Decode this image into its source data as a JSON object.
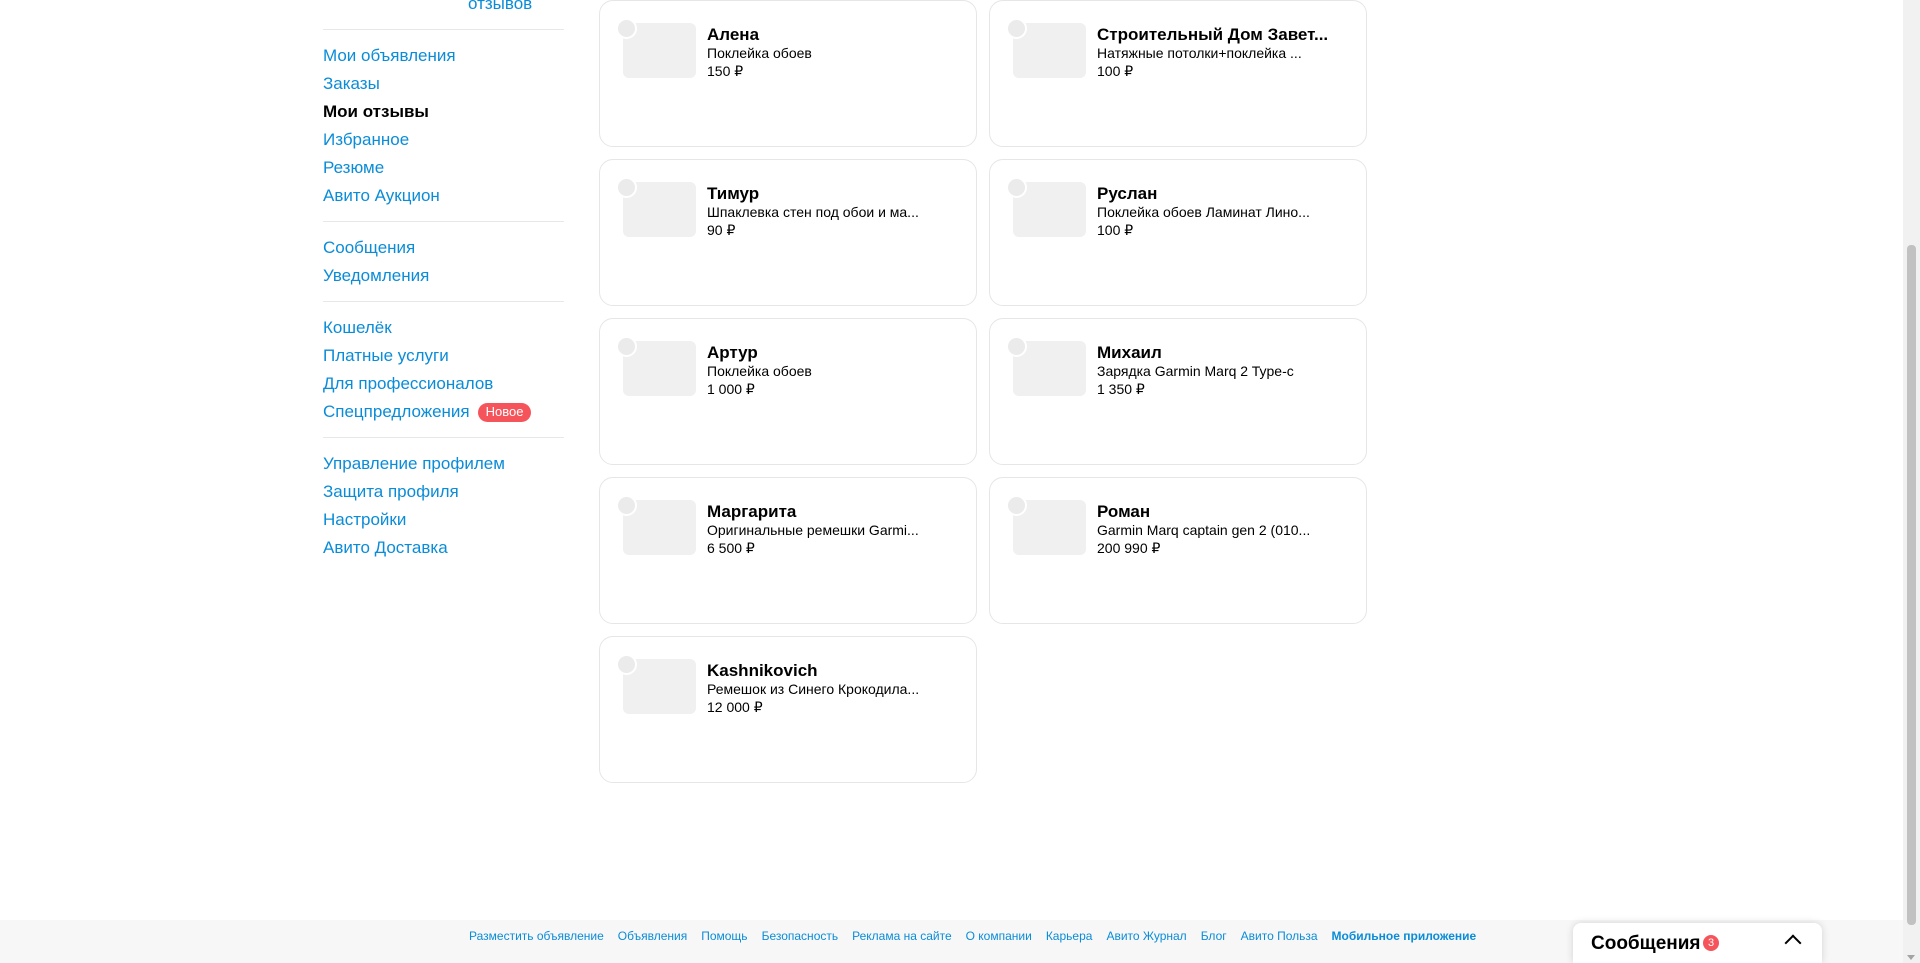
{
  "sidebar": {
    "reviews_fragment": "отзывов",
    "groups": [
      [
        "Мои объявления",
        "Заказы",
        "Мои отзывы",
        "Избранное",
        "Резюме",
        "Авито Аукцион"
      ],
      [
        "Сообщения",
        "Уведомления"
      ],
      [
        "Кошелёк",
        "Платные услуги",
        "Для профессионалов",
        "Спецпредложения"
      ],
      [
        "Управление профилем",
        "Защита профиля",
        "Настройки",
        "Авито Доставка"
      ]
    ],
    "active_item": "Мои отзывы",
    "new_badge": "Новое"
  },
  "cards": [
    {
      "name": "Алена",
      "title": "Поклейка обоев",
      "price": "150 ₽"
    },
    {
      "name": "Строительный Дом Завет...",
      "title": "Натяжные потолки+поклейка ...",
      "price": "100 ₽"
    },
    {
      "name": "Тимур",
      "title": "Шпаклевка стен под обои и ма...",
      "price": "90 ₽"
    },
    {
      "name": "Руслан",
      "title": "Поклейка обоев Ламинат Лино...",
      "price": "100 ₽"
    },
    {
      "name": "Артур",
      "title": "Поклейка обоев",
      "price": "1 000 ₽"
    },
    {
      "name": "Михаил",
      "title": "Зарядка Garmin Marq 2 Type-c",
      "price": "1 350 ₽"
    },
    {
      "name": "Маргарита",
      "title": "Оригинальные ремешки Garmi...",
      "price": "6 500 ₽"
    },
    {
      "name": "Роман",
      "title": "Garmin Marq captain gen 2 (010...",
      "price": "200 990 ₽"
    },
    {
      "name": "Kashnikovich",
      "title": "Ремешок из Синего Крокодила...",
      "price": "12 000 ₽"
    }
  ],
  "footer": {
    "links": [
      "Разместить объявление",
      "Объявления",
      "Помощь",
      "Безопасность",
      "Реклама на сайте",
      "О компании",
      "Карьера",
      "Авито Журнал",
      "Блог",
      "Авито Польза",
      "Мобильное приложение"
    ]
  },
  "messages_panel": {
    "title": "Сообщения",
    "count": "3"
  },
  "colors": {
    "link": "#0a8cd8",
    "badge": "#f5545a",
    "card_border": "#e6e6e6",
    "footer_bg": "#f7f7f7"
  },
  "icons": {
    "collapse": "chevron-up-icon"
  }
}
